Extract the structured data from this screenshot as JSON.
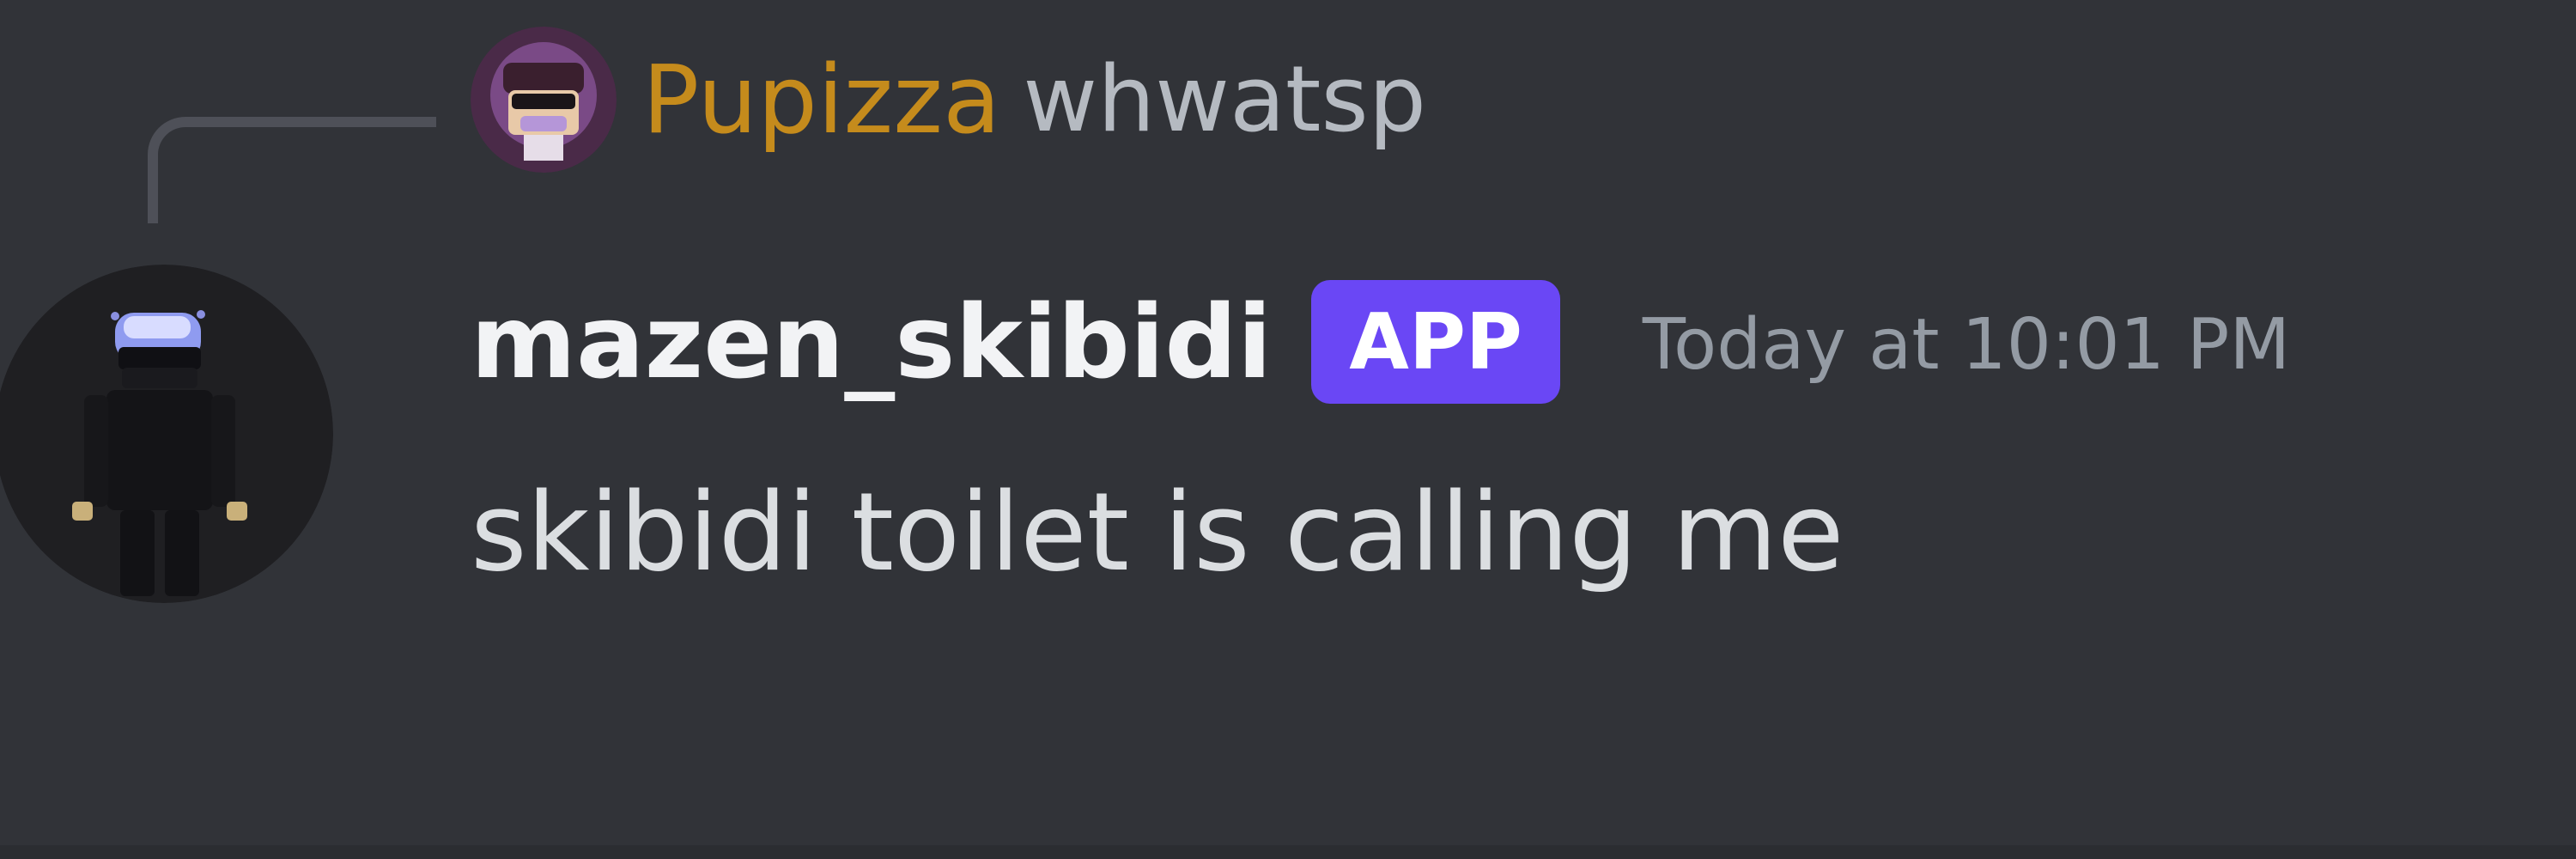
{
  "reply": {
    "author": "Pupizza",
    "text": "whwatsp",
    "author_color": "#c58b1c"
  },
  "message": {
    "author": "mazen_skibidi",
    "badge": "APP",
    "timestamp": "Today at 10:01 PM",
    "content": "skibidi toilet is calling me"
  },
  "colors": {
    "background": "#313338",
    "badge": "#6a47f5",
    "username": "#f2f3f5",
    "timestamp": "#949ba4",
    "text": "#dbdee1"
  },
  "icons": {
    "reply_avatar": "pupizza-avatar-icon",
    "main_avatar": "mazen-skibidi-avatar-icon"
  }
}
